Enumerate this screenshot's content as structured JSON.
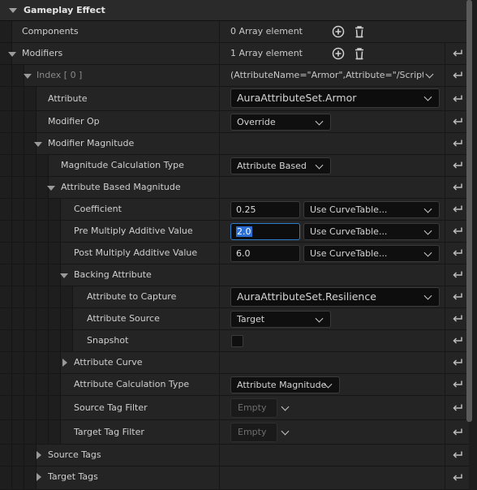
{
  "section": {
    "title": "Gameplay Effect"
  },
  "rows": {
    "components": {
      "label": "Components",
      "value": "0 Array element"
    },
    "modifiers": {
      "label": "Modifiers",
      "value": "1 Array element"
    },
    "index0": {
      "label": "Index [ 0 ]",
      "value": "(AttributeName=\"Armor\",Attribute=\"/Script/."
    },
    "attribute": {
      "label": "Attribute",
      "value": "AuraAttributeSet.Armor"
    },
    "modifier_op": {
      "label": "Modifier Op",
      "value": "Override"
    },
    "modifier_magnitude": {
      "label": "Modifier Magnitude"
    },
    "magnitude_calc_type": {
      "label": "Magnitude Calculation Type",
      "value": "Attribute Based"
    },
    "attribute_based_magnitude": {
      "label": "Attribute Based Magnitude"
    },
    "coefficient": {
      "label": "Coefficient",
      "value": "0.25",
      "curve": "Use CurveTable..."
    },
    "pre_multiply": {
      "label": "Pre Multiply Additive Value",
      "value": "2.0",
      "curve": "Use CurveTable..."
    },
    "post_multiply": {
      "label": "Post Multiply Additive Value",
      "value": "6.0",
      "curve": "Use CurveTable..."
    },
    "backing_attribute": {
      "label": "Backing Attribute"
    },
    "attribute_to_capture": {
      "label": "Attribute to Capture",
      "value": "AuraAttributeSet.Resilience"
    },
    "attribute_source": {
      "label": "Attribute Source",
      "value": "Target"
    },
    "snapshot": {
      "label": "Snapshot",
      "checked": false
    },
    "attribute_curve": {
      "label": "Attribute Curve"
    },
    "attribute_calc_type": {
      "label": "Attribute Calculation Type",
      "value": "Attribute Magnitude"
    },
    "source_tag_filter": {
      "label": "Source Tag Filter",
      "value": "Empty"
    },
    "target_tag_filter": {
      "label": "Target Tag Filter",
      "value": "Empty"
    },
    "source_tags": {
      "label": "Source Tags"
    },
    "target_tags": {
      "label": "Target Tags"
    }
  },
  "icons": {
    "add": "add-circle-icon",
    "delete": "trash-icon",
    "reset": "reset-to-default-icon",
    "expand": "triangle-icon"
  },
  "colors": {
    "selection": "#2b6fd6",
    "focus_border": "#2c7ec9"
  }
}
